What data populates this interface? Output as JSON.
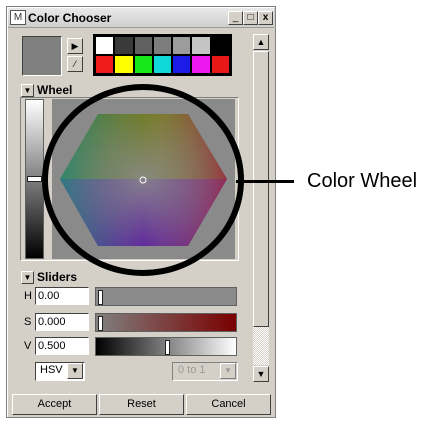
{
  "window": {
    "title": "Color Chooser",
    "min": "_",
    "max": "□",
    "close": "x"
  },
  "current_color": "#808080",
  "icons": {
    "play": "▶",
    "eyedropper": "⁄",
    "dropdown": "▼",
    "up": "▲",
    "down": "▼"
  },
  "swatches": {
    "row1": [
      "#ffffff",
      "#3a3a3a",
      "#606060",
      "#7d7d7d",
      "#9c9c9c",
      "#c4c4c4",
      "#000000"
    ],
    "row2": [
      "#ee1b1b",
      "#ffff00",
      "#18e818",
      "#10d8d8",
      "#1c1ce8",
      "#ee18ee",
      "#e81818"
    ]
  },
  "wheel": {
    "label": "Wheel"
  },
  "callout": "Color Wheel",
  "sliders": {
    "label": "Sliders",
    "h": {
      "letter": "H",
      "value": "0.00",
      "level": 0.0
    },
    "s": {
      "letter": "S",
      "value": "0.000",
      "level": 0.0
    },
    "v": {
      "letter": "V",
      "value": "0.500",
      "level": 0.5
    },
    "space": "HSV",
    "range": "0 to 1"
  },
  "buttons": {
    "accept": "Accept",
    "reset": "Reset",
    "cancel": "Cancel"
  }
}
